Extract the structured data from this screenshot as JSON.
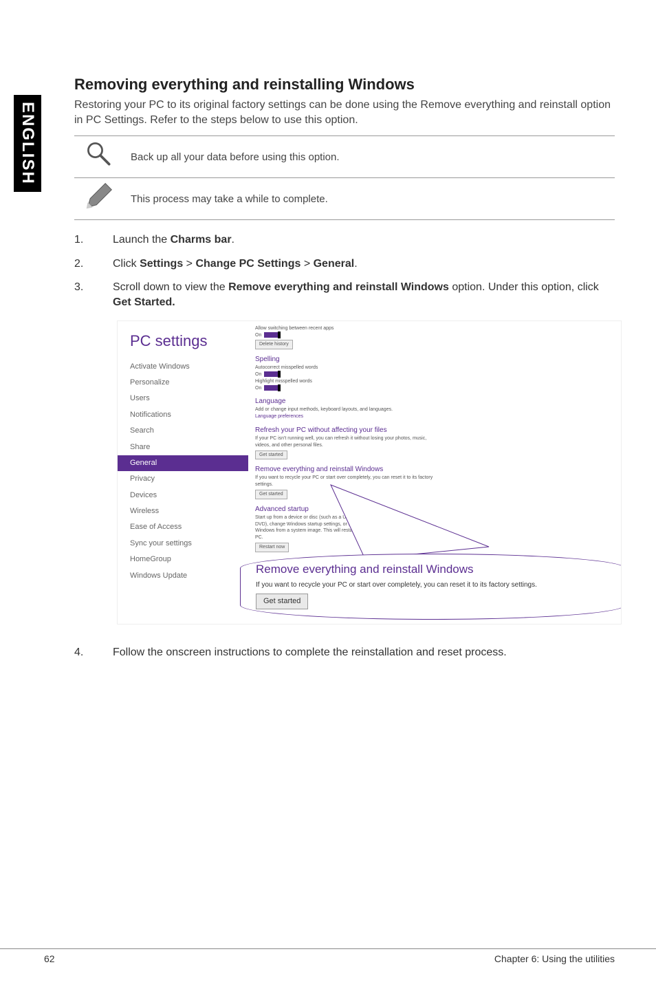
{
  "side_tab": "ENGLISH",
  "section_title": "Removing everything and reinstalling Windows",
  "intro_text": "Restoring your PC to its original factory settings can be done using the Remove everything and reinstall option in PC Settings. Refer to the steps below to use this option.",
  "note1": "Back up all your data before using this option.",
  "note2": "This process may take a while to complete.",
  "steps": {
    "s1_pre": "Launch the ",
    "s1_bold": "Charms bar",
    "s1_post": ".",
    "s2_pre": "Click ",
    "s2_b1": "Settings",
    "s2_sep1": " > ",
    "s2_b2": "Change PC Settings",
    "s2_sep2": " > ",
    "s2_b3": "General",
    "s2_post": ".",
    "s3_pre": "Scroll down to view the ",
    "s3_bold": "Remove everything and reinstall Windows",
    "s3_mid": " option. Under this option, click ",
    "s3_bold2": "Get Started.",
    "s4": "Follow the onscreen instructions to complete the reinstallation and reset process."
  },
  "screenshot": {
    "sidebar_title": "PC settings",
    "items": [
      "Activate Windows",
      "Personalize",
      "Users",
      "Notifications",
      "Search",
      "Share",
      "General",
      "Privacy",
      "Devices",
      "Wireless",
      "Ease of Access",
      "Sync your settings",
      "HomeGroup",
      "Windows Update"
    ],
    "main": {
      "switch_label": "Allow switching between recent apps",
      "on": "On",
      "delete_history": "Delete history",
      "spelling_h": "Spelling",
      "spelling1": "Autocorrect misspelled words",
      "spelling2": "Highlight misspelled words",
      "language_h": "Language",
      "language_text": "Add or change input methods, keyboard layouts, and languages.",
      "language_link": "Language preferences",
      "refresh_h": "Refresh your PC without affecting your files",
      "refresh_text": "If your PC isn't running well, you can refresh it without losing your photos, music, videos, and other personal files.",
      "get_started": "Get started",
      "remove_h": "Remove everything and reinstall Windows",
      "remove_text": "If you want to recycle your PC or start over completely, you can reset it to its factory settings.",
      "advanced_h": "Advanced startup",
      "advanced_text": "Start up from a device or disc (such as a USB drive or DVD), change Windows startup settings, or restore Windows from a system image. This will restart your PC.",
      "restart_now": "Restart now"
    },
    "callout": {
      "title": "Remove everything and reinstall Windows",
      "text": "If you want to recycle your PC or start over completely, you can reset it to its factory settings.",
      "btn": "Get started"
    }
  },
  "footer": {
    "page": "62",
    "chapter": "Chapter 6: Using the utilities"
  }
}
